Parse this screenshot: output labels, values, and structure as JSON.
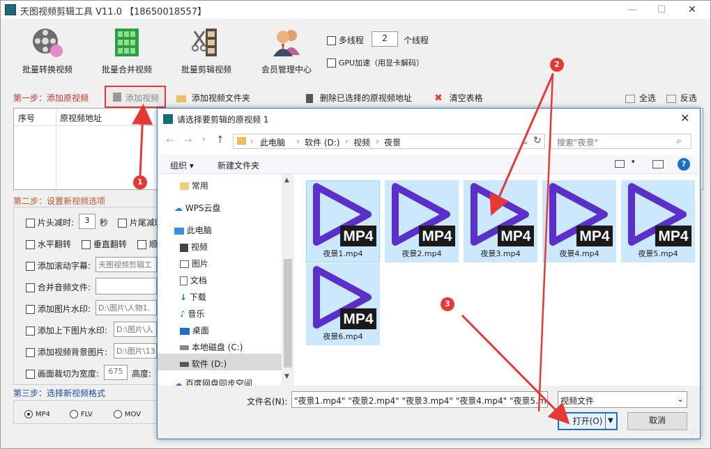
{
  "app": {
    "title": "天图视频剪辑工具 V11.0 【18650018557】",
    "window_controls": [
      "—",
      "☐",
      "✕"
    ]
  },
  "toolbar": {
    "tools": [
      {
        "label": "批量转换视频",
        "icon": "film-reel-icon"
      },
      {
        "label": "批量合并视频",
        "icon": "grid-merge-icon"
      },
      {
        "label": "批量剪辑视频",
        "icon": "film-cut-icon"
      },
      {
        "label": "会员管理中心",
        "icon": "members-icon"
      }
    ],
    "multithread_label": "多线程",
    "thread_count": "2",
    "thread_suffix": "个线程",
    "gpu_label": "GPU加速（用显卡解码）"
  },
  "step1": {
    "label": "第一步：添加原视频",
    "add_video": "添加视频",
    "add_folder": "添加视频文件夹",
    "delete_selected": "删除已选择的原视频地址",
    "clear_table": "清空表格",
    "select_all": "全选",
    "invert": "反选",
    "columns": [
      "序号",
      "原视频地址"
    ]
  },
  "step2": {
    "label": "第二步：设置新视频选项",
    "head_cut": "片头减时:",
    "head_cut_value": "3",
    "head_cut_unit": "秒",
    "tail_cut": "片尾减时",
    "hflip": "水平翻转",
    "vflip": "垂直翻转",
    "rotate": "顺",
    "scroll_caption": "添加滚动字幕:",
    "scroll_caption_value": "天图视频剪辑工",
    "merge_audio": "合并音频文件:",
    "merge_audio_value": "",
    "image_watermark": "添加图片水印:",
    "image_watermark_value": "D:\\图片\\人物1.",
    "topbottom_watermark": "添加上下图片水印:",
    "topbottom_watermark_value": "D:\\图片\\人",
    "bg_image": "添加视频背景图片:",
    "bg_image_value": "D:\\图片\\13",
    "crop_width": "画面裁切为宽度:",
    "crop_width_value": "675",
    "crop_height": "高度:"
  },
  "step3": {
    "label": "第三步：选择新视频格式",
    "formats": [
      "MP4",
      "FLV",
      "MOV"
    ],
    "selected": "MP4"
  },
  "dialog": {
    "title": "请选择要剪辑的原视频 1",
    "breadcrumb": [
      "此电脑",
      "软件 (D:)",
      "视频",
      "夜景"
    ],
    "search_placeholder": "搜索\"夜景\"",
    "organize": "组织 ▾",
    "new_folder": "新建文件夹",
    "nav_items": [
      {
        "label": "常用",
        "icon": "folder-icon"
      },
      {
        "label": "WPS云盘",
        "icon": "cloud-icon"
      },
      {
        "label": "此电脑",
        "icon": "computer-icon"
      },
      {
        "label": "视频",
        "icon": "video-folder-icon"
      },
      {
        "label": "图片",
        "icon": "pictures-icon"
      },
      {
        "label": "文档",
        "icon": "documents-icon"
      },
      {
        "label": "下载",
        "icon": "download-icon"
      },
      {
        "label": "音乐",
        "icon": "music-icon"
      },
      {
        "label": "桌面",
        "icon": "desktop-icon"
      },
      {
        "label": "本地磁盘 (C:)",
        "icon": "drive-icon"
      },
      {
        "label": "软件 (D:)",
        "icon": "drive-icon"
      },
      {
        "label": "百度网盘同步空间",
        "icon": "cloud-sync-icon"
      }
    ],
    "files": [
      "夜景1.mp4",
      "夜景2.mp4",
      "夜景3.mp4",
      "夜景4.mp4",
      "夜景5.mp4",
      "夜景6.mp4"
    ],
    "mp4_badge": "MP4",
    "filename_label": "文件名(N):",
    "filename_value": "\"夜景1.mp4\" \"夜景2.mp4\" \"夜景3.mp4\" \"夜景4.mp4\" \"夜景5.m",
    "filetype_value": "视频文件",
    "open": "打开(O)",
    "cancel": "取消"
  },
  "annotations": {
    "markers": [
      "1",
      "2",
      "3"
    ],
    "color": "#e53935"
  },
  "colors": {
    "play_purple": "#5b2fc9",
    "thumb_bg": "#cce8ff",
    "step_red": "#c0392b",
    "step_blue": "#1a4da0"
  }
}
